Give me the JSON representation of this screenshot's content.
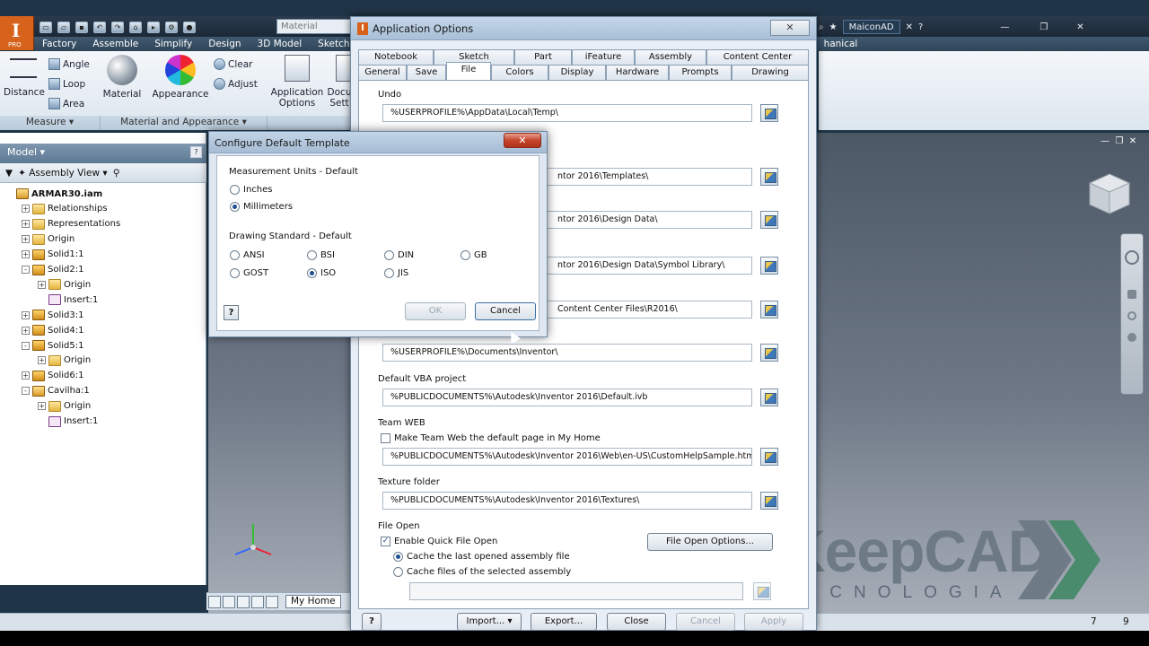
{
  "app": {
    "logo_text": "I",
    "logo_sub": "PRO",
    "material_box": "Material",
    "user": "MaiconAD",
    "ribbon_tabs": [
      "Factory",
      "Assemble",
      "Simplify",
      "Design",
      "3D Model",
      "Sketch"
    ],
    "ribbon_tab_right": "hanical",
    "ribbon_buttons": {
      "distance": "Distance",
      "angle": "Angle",
      "loop": "Loop",
      "area": "Area",
      "material": "Material",
      "appearance": "Appearance",
      "clear": "Clear",
      "adjust": "Adjust",
      "app_options_line1": "Application",
      "app_options_line2": "Options",
      "doc_settings_line1": "Docu",
      "doc_settings_line2": "Sett"
    },
    "ribbon_groups": [
      "Measure ▾",
      "Material and Appearance ▾"
    ],
    "browser": {
      "header": "Model ▾",
      "view": "Assembly View",
      "items": [
        {
          "label": "ARMAR30.iam",
          "indent": 0,
          "icon": "asm",
          "exp": ""
        },
        {
          "label": "Relationships",
          "indent": 1,
          "icon": "folder",
          "exp": "+"
        },
        {
          "label": "Representations",
          "indent": 1,
          "icon": "folder",
          "exp": "+"
        },
        {
          "label": "Origin",
          "indent": 1,
          "icon": "folder",
          "exp": "+"
        },
        {
          "label": "Solid1:1",
          "indent": 1,
          "icon": "part",
          "exp": "+"
        },
        {
          "label": "Solid2:1",
          "indent": 1,
          "icon": "part",
          "exp": "-"
        },
        {
          "label": "Origin",
          "indent": 2,
          "icon": "folder",
          "exp": "+"
        },
        {
          "label": "Insert:1",
          "indent": 2,
          "icon": "ins",
          "exp": ""
        },
        {
          "label": "Solid3:1",
          "indent": 1,
          "icon": "part",
          "exp": "+"
        },
        {
          "label": "Solid4:1",
          "indent": 1,
          "icon": "part",
          "exp": "+"
        },
        {
          "label": "Solid5:1",
          "indent": 1,
          "icon": "part",
          "exp": "-"
        },
        {
          "label": "Origin",
          "indent": 2,
          "icon": "folder",
          "exp": "+"
        },
        {
          "label": "Solid6:1",
          "indent": 1,
          "icon": "part",
          "exp": "+"
        },
        {
          "label": "Cavilha:1",
          "indent": 1,
          "icon": "asm",
          "exp": "-"
        },
        {
          "label": "Origin",
          "indent": 2,
          "icon": "folder",
          "exp": "+"
        },
        {
          "label": "Insert:1",
          "indent": 2,
          "icon": "ins",
          "exp": ""
        }
      ]
    },
    "my_home": "My Home",
    "status": {
      "n1": "7",
      "n2": "9"
    }
  },
  "watermark": {
    "brand": "KeepCAD",
    "sub": "TECNOLOGIA"
  },
  "app_options": {
    "title": "Application Options",
    "tabs_top": [
      "Notebook",
      "Sketch",
      "Part",
      "iFeature",
      "Assembly",
      "Content Center"
    ],
    "tabs_bottom": [
      "General",
      "Save",
      "File",
      "Colors",
      "Display",
      "Hardware",
      "Prompts",
      "Drawing"
    ],
    "active_tab": "File",
    "undo_label": "Undo",
    "undo_path": "%USERPROFILE%\\AppData\\Local\\Temp\\",
    "path_templates": "ntor 2016\\Templates\\",
    "path_design_data": "ntor 2016\\Design Data\\",
    "path_symbol_lib": "ntor 2016\\Design Data\\Symbol Library\\",
    "path_content_center": "Content Center Files\\R2016\\",
    "path_documents": "%USERPROFILE%\\Documents\\Inventor\\",
    "vba_label": "Default VBA project",
    "vba_path": "%PUBLICDOCUMENTS%\\Autodesk\\Inventor 2016\\Default.ivb",
    "team_web_label": "Team WEB",
    "team_web_check": "Make Team Web the default page in My Home",
    "team_web_path": "%PUBLICDOCUMENTS%\\Autodesk\\Inventor 2016\\Web\\en-US\\CustomHelpSample.htm",
    "texture_label": "Texture folder",
    "texture_path": "%PUBLICDOCUMENTS%\\Autodesk\\Inventor 2016\\Textures\\",
    "file_open_label": "File Open",
    "quick_open": "Enable Quick File Open",
    "cache_last": "Cache the last opened assembly file",
    "cache_selected": "Cache files of the selected assembly",
    "file_open_options": "File Open Options...",
    "buttons": {
      "import": "Import...",
      "export": "Export...",
      "close": "Close",
      "cancel": "Cancel",
      "apply": "Apply"
    }
  },
  "configure_template": {
    "title": "Configure Default Template",
    "units_label": "Measurement Units - Default",
    "inches": "Inches",
    "millimeters": "Millimeters",
    "standard_label": "Drawing Standard - Default",
    "standards": [
      "ANSI",
      "BSI",
      "DIN",
      "GB",
      "GOST",
      "ISO",
      "JIS"
    ],
    "selected_unit": "Millimeters",
    "selected_standard": "ISO",
    "ok": "OK",
    "cancel": "Cancel",
    "help": "?"
  }
}
